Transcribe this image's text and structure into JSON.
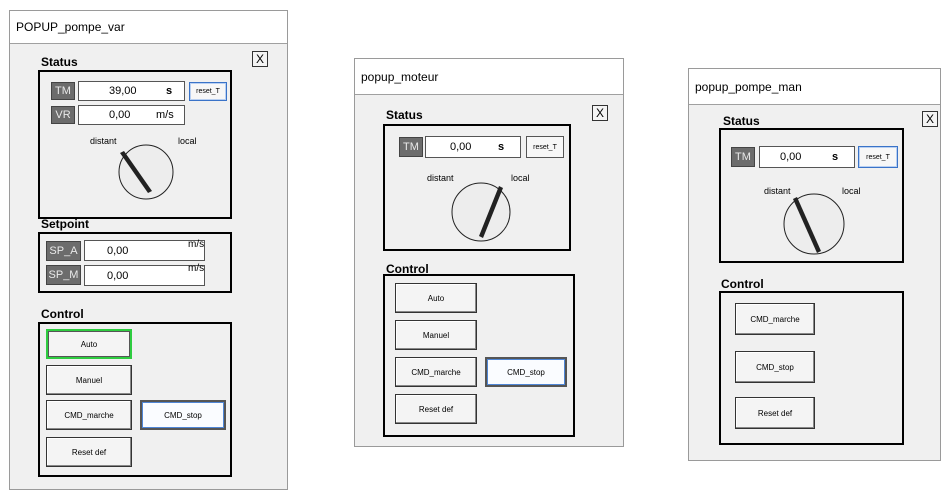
{
  "popups": [
    {
      "title": "POPUP_pompe_var",
      "close_label": "X",
      "status": {
        "title": "Status",
        "tm": {
          "tag": "TM",
          "value": "39,00",
          "unit": "s",
          "reset_label": "reset_T"
        },
        "vr": {
          "tag": "VR",
          "value": "0,00",
          "unit": "m/s"
        },
        "selector": {
          "left_label": "distant",
          "right_label": "local"
        }
      },
      "setpoint": {
        "title": "Setpoint",
        "sp_a": {
          "tag": "SP_A",
          "value": "0,00",
          "unit": "m/s"
        },
        "sp_m": {
          "tag": "SP_M",
          "value": "0,00",
          "unit": "m/s"
        }
      },
      "control": {
        "title": "Control",
        "auto": "Auto",
        "manuel": "Manuel",
        "cmd_marche": "CMD_marche",
        "cmd_stop": "CMD_stop",
        "reset_def": "Reset def"
      }
    },
    {
      "title": "popup_moteur",
      "close_label": "X",
      "status": {
        "title": "Status",
        "tm": {
          "tag": "TM",
          "value": "0,00",
          "unit": "s",
          "reset_label": "reset_T"
        },
        "selector": {
          "left_label": "distant",
          "right_label": "local"
        }
      },
      "control": {
        "title": "Control",
        "auto": "Auto",
        "manuel": "Manuel",
        "cmd_marche": "CMD_marche",
        "cmd_stop": "CMD_stop",
        "reset_def": "Reset def"
      }
    },
    {
      "title": "popup_pompe_man",
      "close_label": "X",
      "status": {
        "title": "Status",
        "tm": {
          "tag": "TM",
          "value": "0,00",
          "unit": "s",
          "reset_label": "reset_T"
        },
        "selector": {
          "left_label": "distant",
          "right_label": "local"
        }
      },
      "control": {
        "title": "Control",
        "cmd_marche": "CMD_marche",
        "cmd_stop": "CMD_stop",
        "reset_def": "Reset def"
      }
    }
  ]
}
